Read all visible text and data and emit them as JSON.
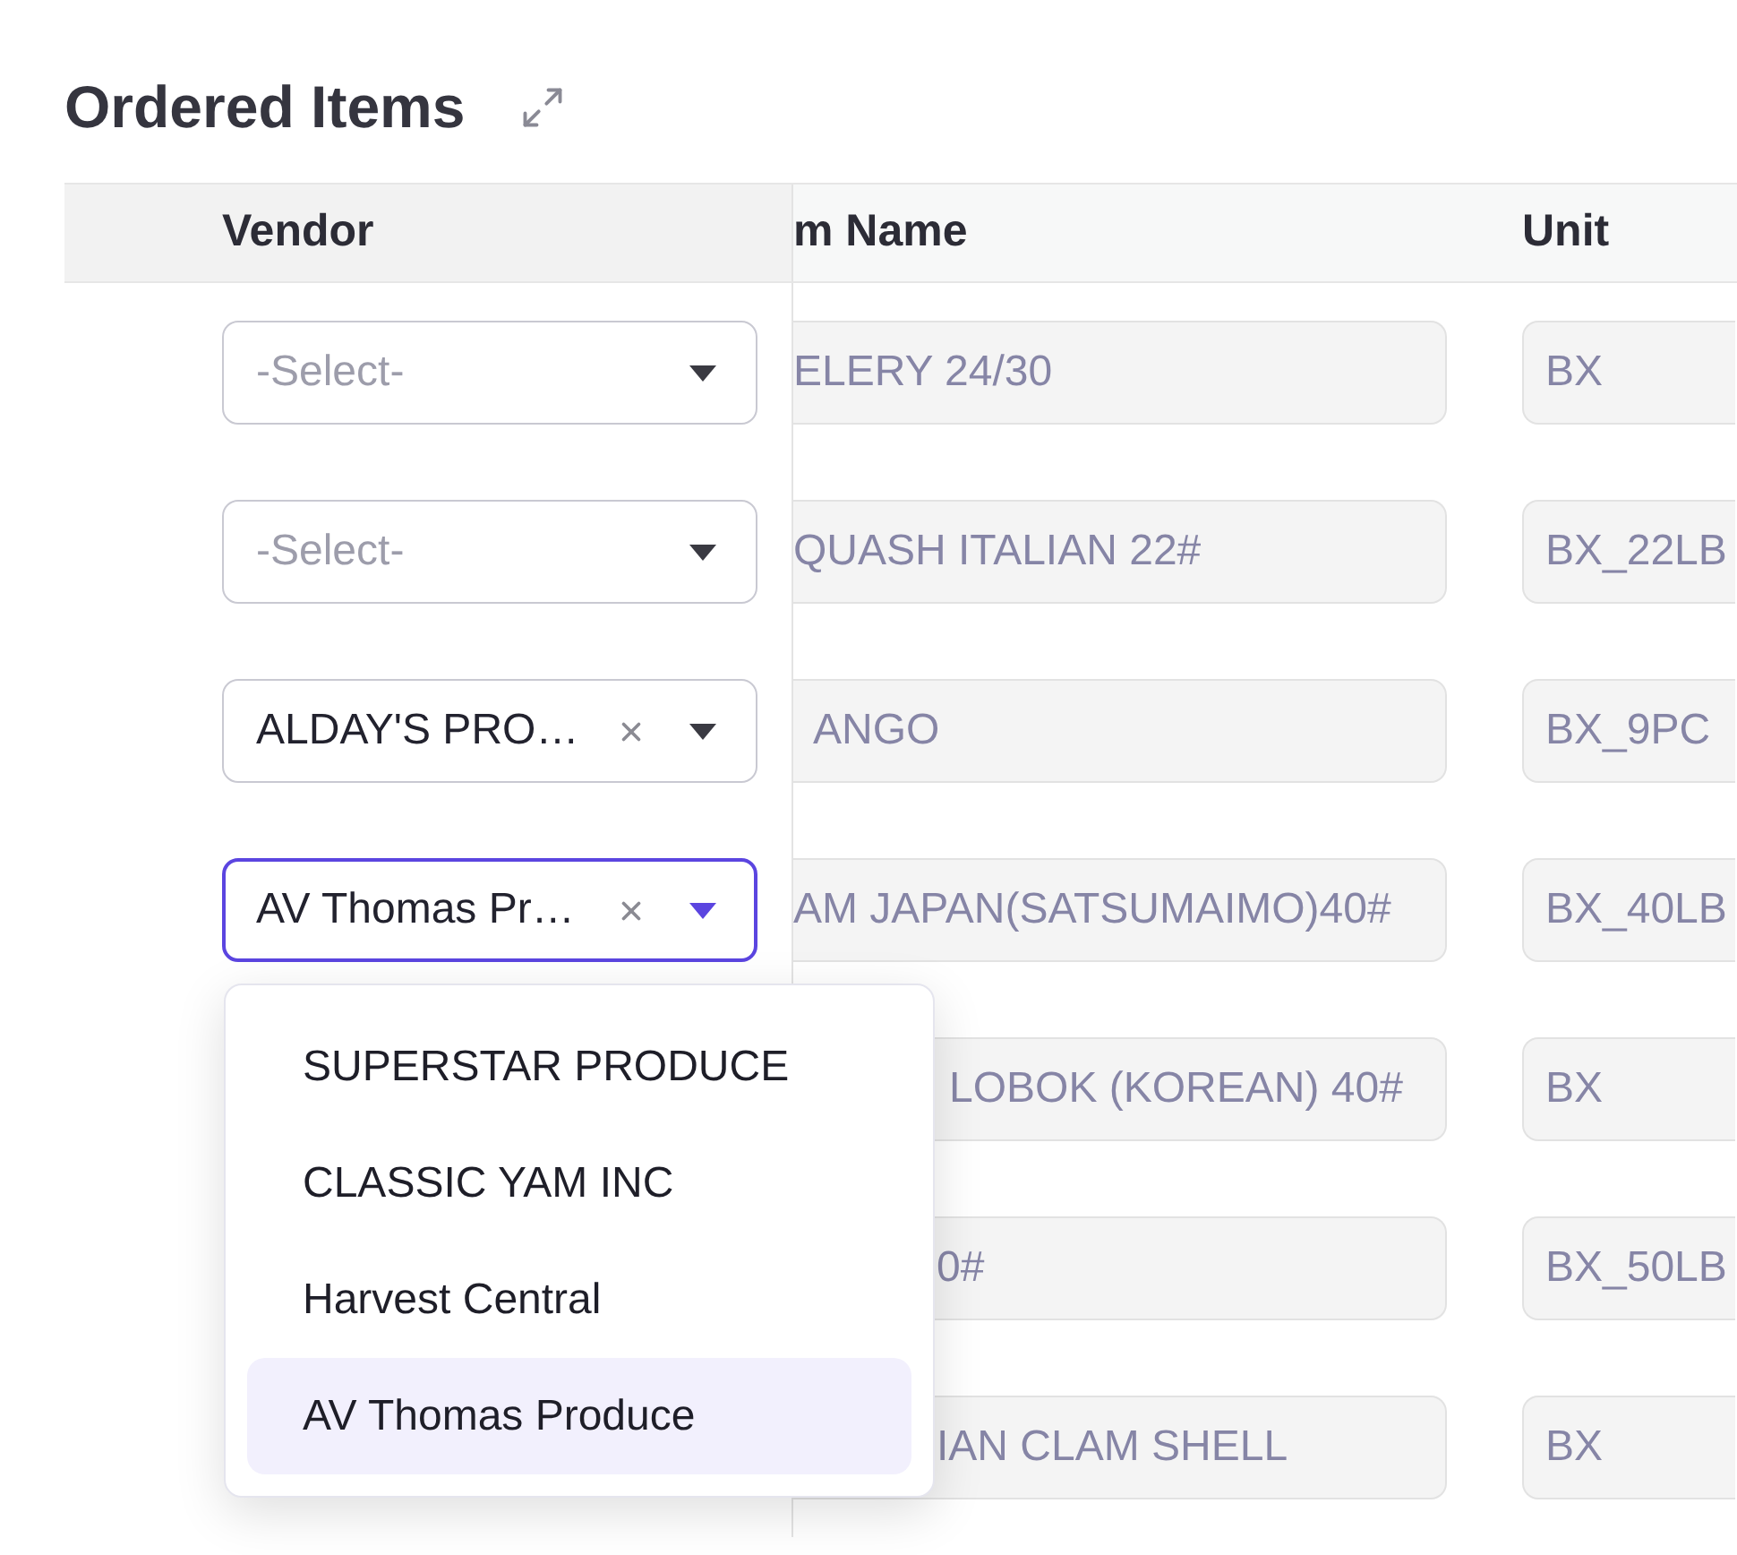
{
  "section": {
    "title": "Ordered Items"
  },
  "table": {
    "columns": [
      {
        "label": "Vendor"
      },
      {
        "label": "m Name"
      },
      {
        "label": "Unit"
      }
    ],
    "rows": [
      {
        "vendor": {
          "placeholder": "-Select-",
          "focused": false
        },
        "item_name": "ELERY 24/30",
        "unit": "BX"
      },
      {
        "vendor": {
          "placeholder": "-Select-",
          "focused": false
        },
        "item_name": "QUASH ITALIAN 22#",
        "unit": "BX_22LB"
      },
      {
        "vendor": {
          "value": "ALDAY'S PRO…",
          "focused": false
        },
        "item_name": "ANGO",
        "unit": "BX_9PC"
      },
      {
        "vendor": {
          "value": "AV Thomas Pr…",
          "focused": true
        },
        "item_name": "AM JAPAN(SATSUMAIMO)40#",
        "unit": "BX_40LB"
      },
      {
        "item_name": "LOBOK (KOREAN) 40#",
        "unit": "BX"
      },
      {
        "item_name": "0#",
        "unit": "BX_50LB"
      },
      {
        "item_name": "IAN CLAM SHELL",
        "unit": "BX"
      }
    ]
  },
  "vendor_dropdown": {
    "options": [
      {
        "label": "SUPERSTAR PRODUCE",
        "selected": false
      },
      {
        "label": "CLASSIC YAM INC",
        "selected": false
      },
      {
        "label": "Harvest Central",
        "selected": false
      },
      {
        "label": "AV Thomas Produce",
        "selected": true
      }
    ]
  }
}
